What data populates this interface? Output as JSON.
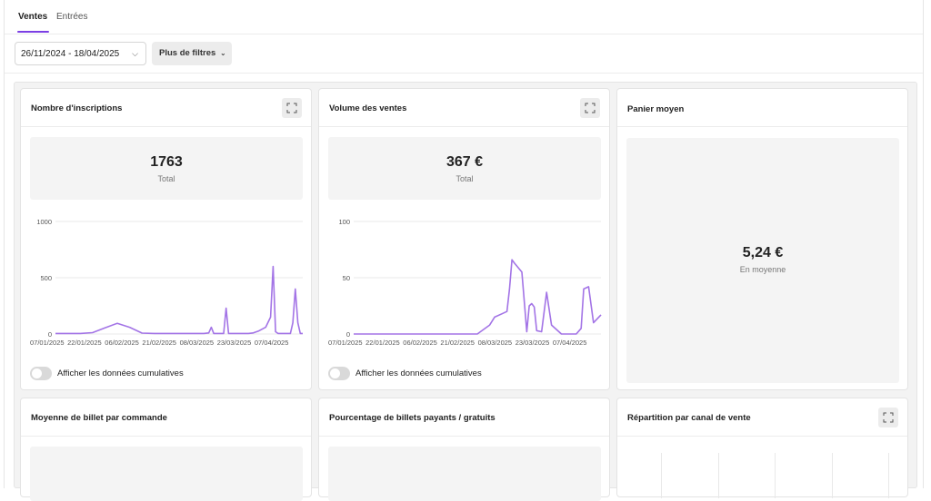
{
  "tabs": [
    {
      "label": "Ventes",
      "active": true
    },
    {
      "label": "Entrées",
      "active": false
    }
  ],
  "filters": {
    "date_range": "26/11/2024 - 18/04/2025",
    "more_filters": "Plus de filtres"
  },
  "cards": {
    "inscriptions": {
      "title": "Nombre d'inscriptions",
      "value": "1763",
      "value_label": "Total",
      "toggle_label": "Afficher les données cumulatives"
    },
    "ventes": {
      "title": "Volume des ventes",
      "value": "367 €",
      "value_label": "Total",
      "toggle_label": "Afficher les données cumulatives"
    },
    "panier": {
      "title": "Panier moyen",
      "value": "5,24 €",
      "value_label": "En moyenne"
    },
    "moyenne_billet": {
      "title": "Moyenne de billet par commande"
    },
    "pourcentage": {
      "title": "Pourcentage de billets payants / gratuits"
    },
    "repartition": {
      "title": "Répartition par canal de vente"
    }
  },
  "colors": {
    "accent": "#7b3fe4",
    "line": "#a374e6"
  },
  "chart_data": [
    {
      "type": "line",
      "yticks": [
        0,
        500,
        1000
      ],
      "ylim": [
        0,
        1000
      ],
      "xticks": [
        "07/01/2025",
        "22/01/2025",
        "06/02/2025",
        "21/02/2025",
        "08/03/2025",
        "23/03/2025",
        "07/04/2025"
      ],
      "x": [
        0,
        0.05,
        0.1,
        0.15,
        0.2,
        0.25,
        0.3,
        0.35,
        0.4,
        0.45,
        0.5,
        0.55,
        0.6,
        0.62,
        0.63,
        0.64,
        0.67,
        0.68,
        0.69,
        0.7,
        0.72,
        0.76,
        0.78,
        0.8,
        0.82,
        0.85,
        0.87,
        0.88,
        0.89,
        0.9,
        0.92,
        0.94,
        0.95,
        0.96,
        0.97,
        0.98,
        0.99,
        1.0
      ],
      "series": [
        {
          "values": [
            5,
            5,
            5,
            12,
            55,
            95,
            60,
            8,
            5,
            5,
            5,
            5,
            5,
            10,
            60,
            5,
            5,
            5,
            230,
            5,
            5,
            5,
            5,
            10,
            25,
            60,
            150,
            600,
            20,
            5,
            5,
            5,
            5,
            100,
            400,
            100,
            5,
            5
          ]
        }
      ]
    },
    {
      "type": "line",
      "yticks": [
        0,
        50,
        100
      ],
      "ylim": [
        0,
        100
      ],
      "xticks": [
        "07/01/2025",
        "22/01/2025",
        "06/02/2025",
        "21/02/2025",
        "08/03/2025",
        "23/03/2025",
        "07/04/2025"
      ],
      "x": [
        0,
        0.1,
        0.2,
        0.3,
        0.35,
        0.4,
        0.45,
        0.5,
        0.55,
        0.57,
        0.6,
        0.62,
        0.63,
        0.64,
        0.65,
        0.68,
        0.7,
        0.71,
        0.72,
        0.73,
        0.74,
        0.76,
        0.78,
        0.8,
        0.84,
        0.88,
        0.9,
        0.92,
        0.93,
        0.95,
        0.97,
        1.0
      ],
      "series": [
        {
          "values": [
            0,
            0,
            0,
            0,
            0,
            0,
            0,
            0,
            8,
            15,
            18,
            20,
            40,
            66,
            63,
            55,
            2,
            25,
            27,
            24,
            3,
            2,
            37,
            8,
            0,
            0,
            0,
            5,
            40,
            42,
            10,
            17
          ]
        }
      ]
    }
  ]
}
